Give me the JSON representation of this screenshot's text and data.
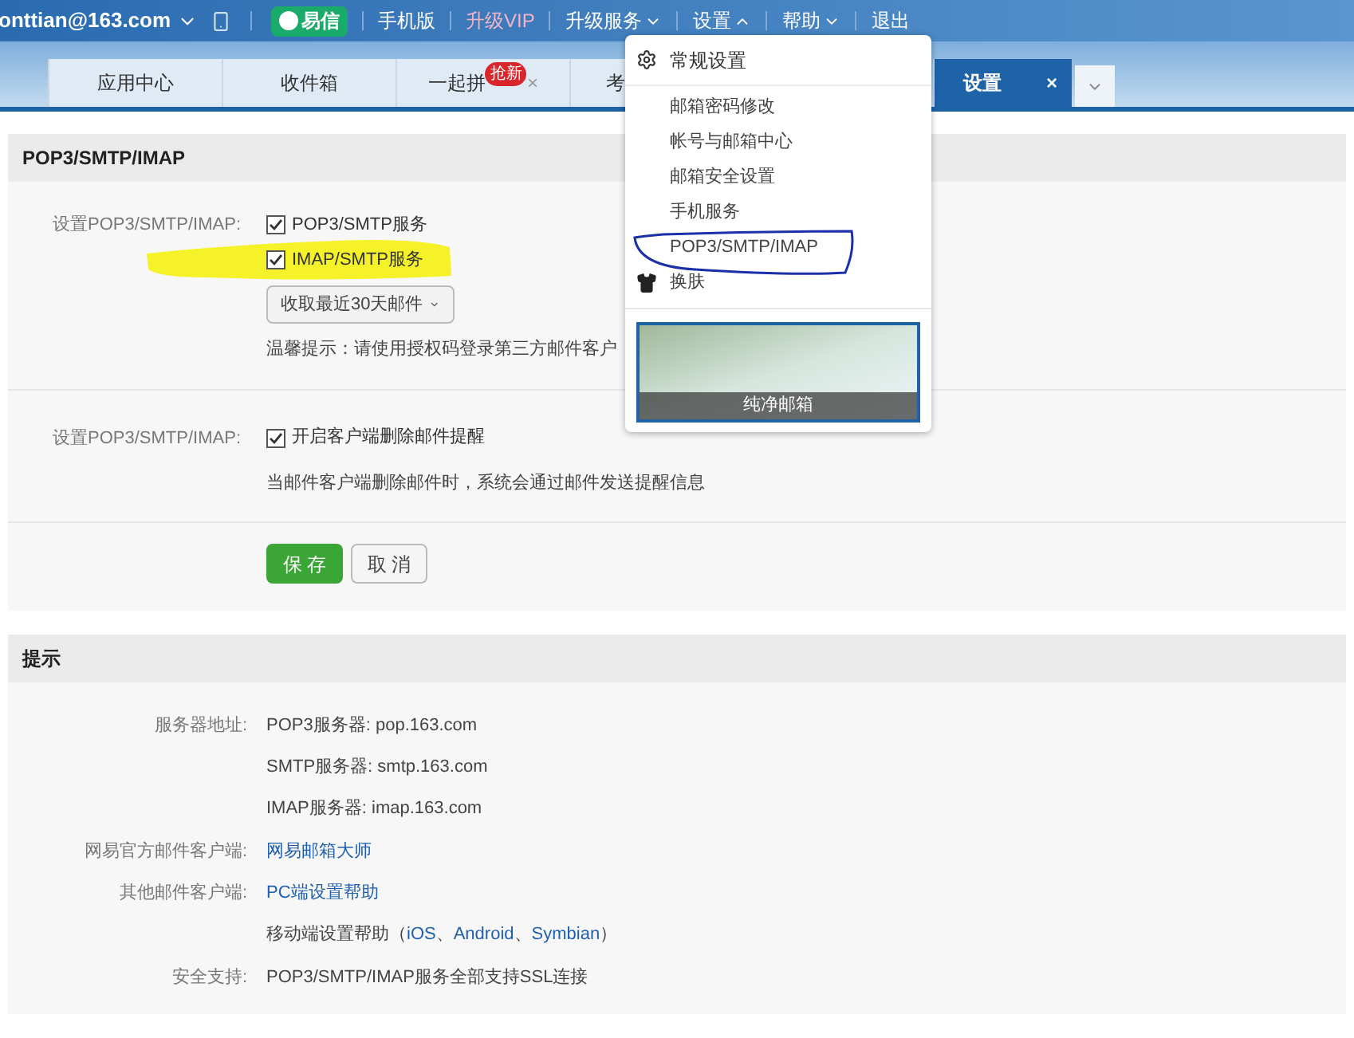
{
  "top_bar": {
    "account": "onttian@163.com",
    "yixin": "易信",
    "links": [
      {
        "label": "手机版",
        "kind": "plain"
      },
      {
        "label": "升级VIP",
        "kind": "vip"
      },
      {
        "label": "升级服务",
        "kind": "menu",
        "expanded": false
      },
      {
        "label": "设置",
        "kind": "menu",
        "expanded": true
      },
      {
        "label": "帮助",
        "kind": "menu",
        "expanded": false
      },
      {
        "label": "退出",
        "kind": "plain"
      }
    ]
  },
  "tabs": [
    {
      "label": "应用中心",
      "selected": false
    },
    {
      "label": "收件箱",
      "selected": false
    },
    {
      "label": "一起拼",
      "selected": false,
      "badge": "抢新",
      "close": "×"
    },
    {
      "label": "考",
      "selected": false
    },
    {
      "label": "设置",
      "selected": true,
      "close": "×"
    }
  ],
  "settings_menu": {
    "items": [
      {
        "label": "常规设置",
        "kind": "header"
      },
      {
        "label": "邮箱密码修改",
        "kind": "sub"
      },
      {
        "label": "帐号与邮箱中心",
        "kind": "sub"
      },
      {
        "label": "邮箱安全设置",
        "kind": "sub"
      },
      {
        "label": "手机服务",
        "kind": "sub"
      },
      {
        "label": "POP3/SMTP/IMAP",
        "kind": "sub"
      },
      {
        "label": "换肤",
        "kind": "skin"
      }
    ],
    "skin_caption": "纯净邮箱"
  },
  "pop3_section": {
    "title": "POP3/SMTP/IMAP",
    "row1_label": "设置POP3/SMTP/IMAP:",
    "services": [
      {
        "label": "POP3/SMTP服务",
        "checked": true
      },
      {
        "label": "IMAP/SMTP服务",
        "checked": true
      }
    ],
    "fetch_select": "收取最近30天邮件",
    "hint": "温馨提示：请使用授权码登录第三方邮件客户",
    "row2_label": "设置POP3/SMTP/IMAP:",
    "delete_alert": {
      "label": "开启客户端删除邮件提醒",
      "checked": true
    },
    "delete_desc": "当邮件客户端删除邮件时，系统会通过邮件发送提醒信息",
    "save": "保 存",
    "cancel": "取 消"
  },
  "tips_section": {
    "title": "提示",
    "rows": [
      {
        "label": "服务器地址:",
        "kind": "text",
        "value": "POP3服务器: pop.163.com"
      },
      {
        "kind": "text",
        "value": "SMTP服务器: smtp.163.com"
      },
      {
        "kind": "text",
        "value": "IMAP服务器: imap.163.com"
      },
      {
        "label": "网易官方邮件客户端:",
        "kind": "link",
        "value": "网易邮箱大师"
      },
      {
        "label": "其他邮件客户端:",
        "kind": "link",
        "value": "PC端设置帮助"
      },
      {
        "kind": "mobile",
        "value": "移动端设置帮助（",
        "links": [
          "iOS",
          "Android",
          "Symbian"
        ],
        "separator": "、",
        "close": "）"
      },
      {
        "label": "安全支持:",
        "kind": "text",
        "value": "POP3/SMTP/IMAP服务全部支持SSL连接"
      }
    ]
  }
}
